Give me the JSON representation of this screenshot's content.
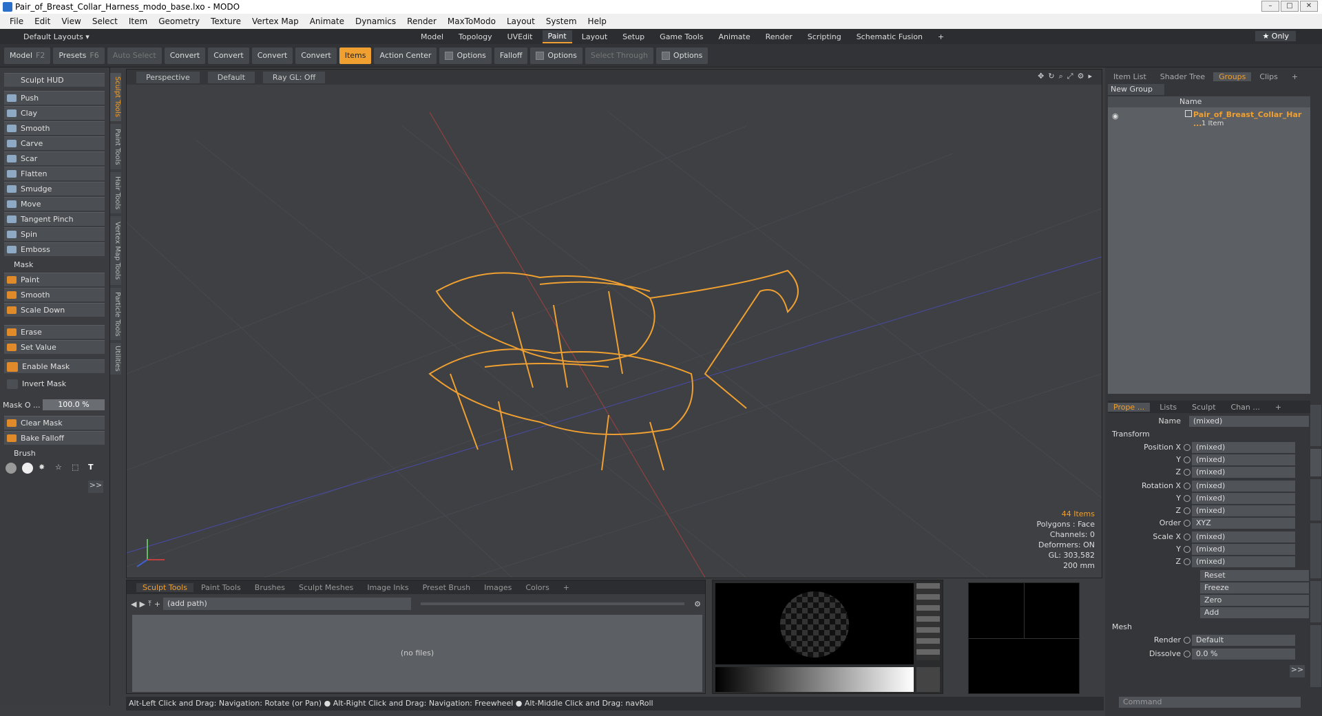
{
  "title": "Pair_of_Breast_Collar_Harness_modo_base.lxo - MODO",
  "menu": [
    "File",
    "Edit",
    "View",
    "Select",
    "Item",
    "Geometry",
    "Texture",
    "Vertex Map",
    "Animate",
    "Dynamics",
    "Render",
    "MaxToModo",
    "Layout",
    "System",
    "Help"
  ],
  "layout": {
    "label": "Default Layouts ▾",
    "tabs": [
      "Model",
      "Topology",
      "UVEdit",
      "Paint",
      "Layout",
      "Setup",
      "Game Tools",
      "Animate",
      "Render",
      "Scripting",
      "Schematic Fusion",
      "+"
    ],
    "active": "Paint",
    "only": "★ Only"
  },
  "toolbar": {
    "model": "Model",
    "model_key": "F2",
    "presets": "Presets",
    "presets_key": "F6",
    "auto_select": "Auto Select",
    "convert": "Convert",
    "items": "Items",
    "action_center": "Action Center",
    "options": "Options",
    "falloff": "Falloff",
    "select_through": "Select Through"
  },
  "left": {
    "hud": "Sculpt HUD",
    "tools": [
      "Push",
      "Clay",
      "Smooth",
      "Carve",
      "Scar",
      "Flatten",
      "Smudge",
      "Move",
      "Tangent Pinch",
      "Spin",
      "Emboss"
    ],
    "mask": "Mask",
    "mask_tools": [
      "Paint",
      "Smooth",
      "Scale Down"
    ],
    "erase": "Erase",
    "set_value": "Set Value",
    "enable_mask": "Enable Mask",
    "invert_mask": "Invert Mask",
    "mask_opacity_label": "Mask O ...",
    "mask_opacity": "100.0 %",
    "clear_mask": "Clear Mask",
    "bake_falloff": "Bake Falloff",
    "brush": "Brush",
    "more": ">>",
    "vtabs": [
      "Sculpt Tools",
      "Paint Tools",
      "Hair Tools",
      "Vertex Map Tools",
      "Particle Tools",
      "Utilities"
    ]
  },
  "viewport": {
    "view": "Perspective",
    "shading": "Default",
    "raygl": "Ray GL: Off",
    "stats": {
      "items": "44 Items",
      "polygons": "Polygons : Face",
      "channels": "Channels: 0",
      "deformers": "Deformers: ON",
      "gl": "GL: 303,582",
      "scale": "200 mm"
    }
  },
  "bottom": {
    "tabs": [
      "Sculpt Tools",
      "Paint Tools",
      "Brushes",
      "Sculpt Meshes",
      "Image Inks",
      "Preset Brush",
      "Images",
      "Colors",
      "+"
    ],
    "path": "(add path)",
    "empty": "(no files)"
  },
  "status": "Alt-Left Click and Drag: Navigation: Rotate (or Pan) ● Alt-Right Click and Drag: Navigation: Freewheel ● Alt-Middle Click and Drag: navRoll",
  "right": {
    "tabs1": [
      "Item List",
      "Shader Tree",
      "Groups",
      "Clips",
      "+"
    ],
    "active1": "Groups",
    "new_group": "New Group",
    "col_name": "Name",
    "group_name": "Pair_of_Breast_Collar_Har ...",
    "group_sub": "1 Item",
    "tabs2": [
      "Prope ...",
      "Lists",
      "Sculpt",
      "Chan ...",
      "+"
    ],
    "active2": "Prope ...",
    "name_label": "Name",
    "name_value": "(mixed)",
    "transform": "Transform",
    "rows": [
      {
        "l": "Position X",
        "v": "(mixed)"
      },
      {
        "l": "Y",
        "v": "(mixed)"
      },
      {
        "l": "Z",
        "v": "(mixed)"
      },
      {
        "l": "Rotation X",
        "v": "(mixed)"
      },
      {
        "l": "Y",
        "v": "(mixed)"
      },
      {
        "l": "Z",
        "v": "(mixed)"
      },
      {
        "l": "Order",
        "v": "XYZ"
      },
      {
        "l": "Scale X",
        "v": "(mixed)"
      },
      {
        "l": "Y",
        "v": "(mixed)"
      },
      {
        "l": "Z",
        "v": "(mixed)"
      }
    ],
    "actions": [
      "Reset",
      "Freeze",
      "Zero",
      "Add"
    ],
    "mesh": "Mesh",
    "render_label": "Render",
    "render_value": "Default",
    "dissolve_label": "Dissolve",
    "dissolve_value": "0.0 %",
    "more": ">>",
    "command": "Command"
  }
}
